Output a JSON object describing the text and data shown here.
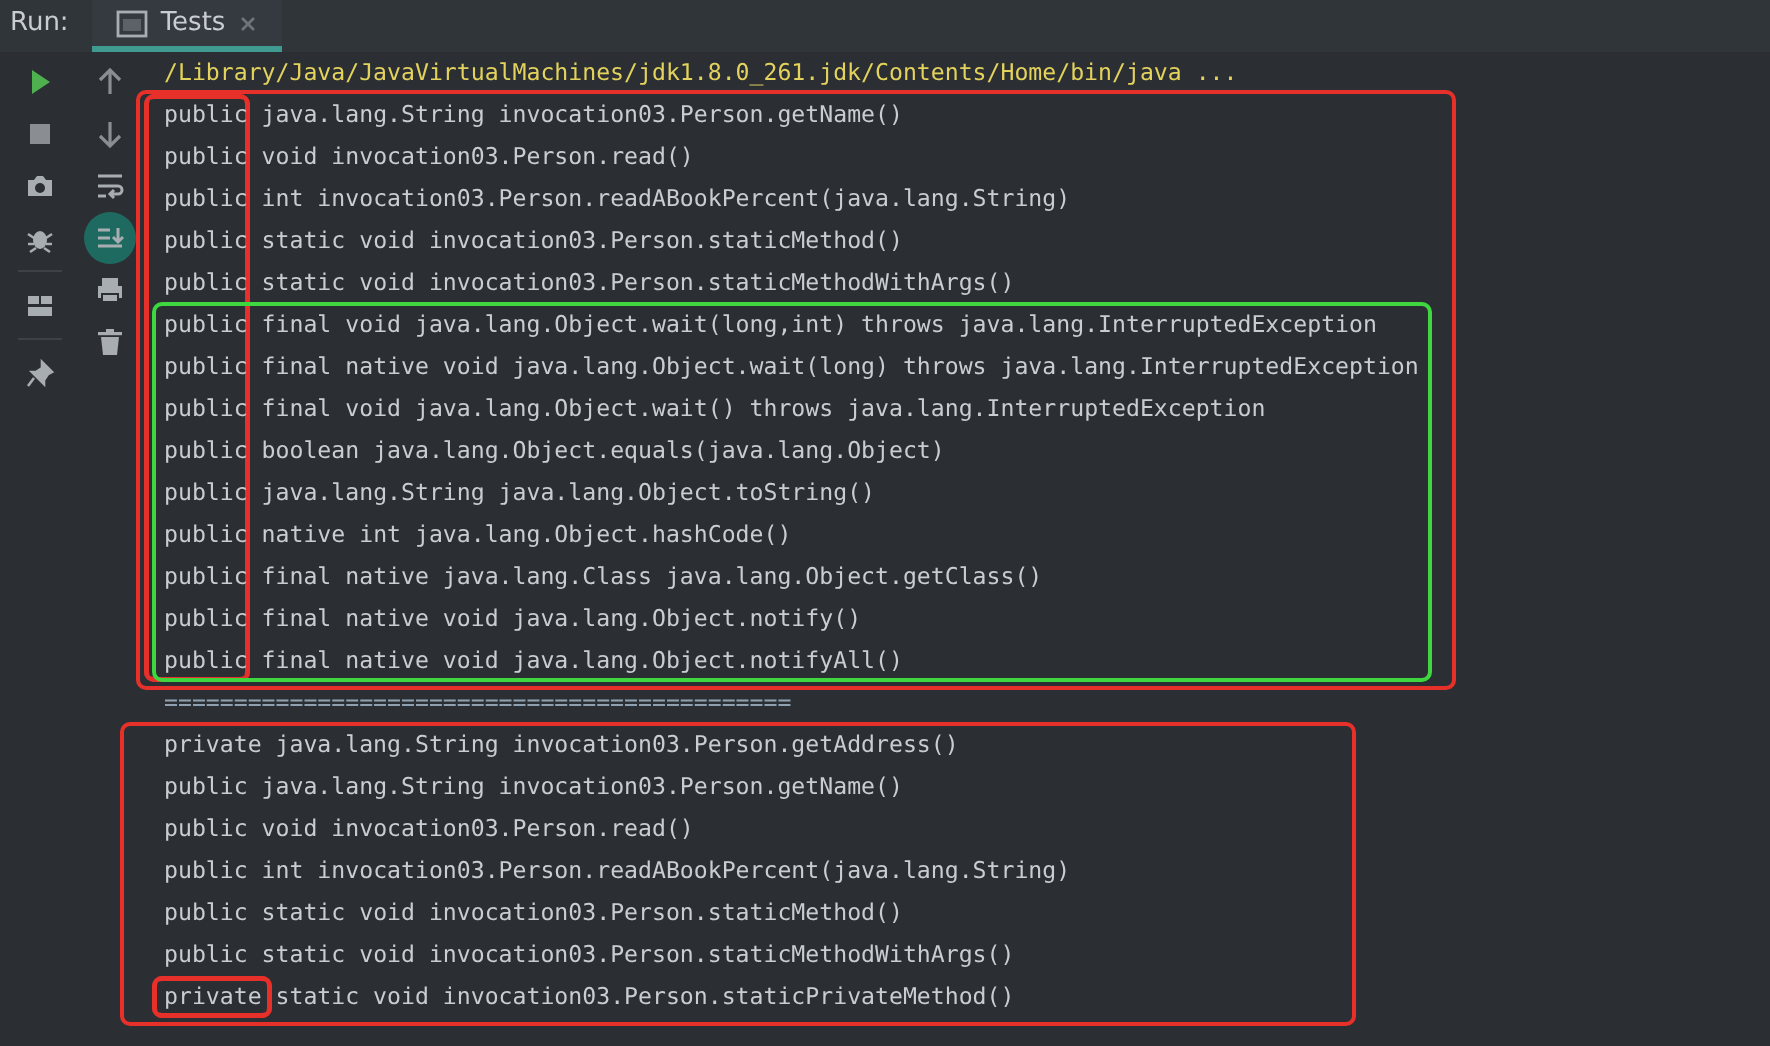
{
  "run_label": "Run:",
  "tab": {
    "label": "Tests",
    "selected": true
  },
  "actions": [
    {
      "kind": "run"
    },
    {
      "kind": "stop"
    },
    {
      "kind": "camera"
    },
    {
      "kind": "bug"
    },
    {
      "kind": "layout"
    },
    {
      "kind": "pin"
    }
  ],
  "toggles": [
    {
      "kind": "up",
      "on": false
    },
    {
      "kind": "down",
      "on": false
    },
    {
      "kind": "wrap",
      "on": false
    },
    {
      "kind": "scroll-end",
      "on": true
    },
    {
      "kind": "print",
      "on": false
    },
    {
      "kind": "trash",
      "on": false
    }
  ],
  "console": {
    "command": "/Library/Java/JavaVirtualMachines/jdk1.8.0_261.jdk/Contents/Home/bin/java ...",
    "blocks": [
      {
        "kind": "frame",
        "color": "#e8302a",
        "children": [
          {
            "kind": "line",
            "keyword": "public",
            "rest": "java.lang.String invocation03.Person.getName()",
            "keyword_marked": true
          },
          {
            "kind": "line",
            "keyword": "public",
            "rest": "void invocation03.Person.read()",
            "keyword_marked": true
          },
          {
            "kind": "line",
            "keyword": "public",
            "rest": "int invocation03.Person.readABookPercent(java.lang.String)",
            "keyword_marked": true
          },
          {
            "kind": "line",
            "keyword": "public",
            "rest": "static void invocation03.Person.staticMethod()",
            "keyword_marked": true
          },
          {
            "kind": "line",
            "keyword": "public",
            "rest": "static void invocation03.Person.staticMethodWithArgs()",
            "keyword_marked": true
          },
          {
            "kind": "frame",
            "color": "#3fd73f",
            "children": [
              {
                "kind": "line",
                "keyword": "public",
                "rest": "final void java.lang.Object.wait(long,int) throws java.lang.InterruptedException",
                "keyword_marked": true
              },
              {
                "kind": "line",
                "keyword": "public",
                "rest": "final native void java.lang.Object.wait(long) throws java.lang.InterruptedException",
                "keyword_marked": true
              },
              {
                "kind": "line",
                "keyword": "public",
                "rest": "final void java.lang.Object.wait() throws java.lang.InterruptedException",
                "keyword_marked": true
              },
              {
                "kind": "line",
                "keyword": "public",
                "rest": "boolean java.lang.Object.equals(java.lang.Object)",
                "keyword_marked": true
              },
              {
                "kind": "line",
                "keyword": "public",
                "rest": "java.lang.String java.lang.Object.toString()",
                "keyword_marked": true
              },
              {
                "kind": "line",
                "keyword": "public",
                "rest": "native int java.lang.Object.hashCode()",
                "keyword_marked": true
              },
              {
                "kind": "line",
                "keyword": "public",
                "rest": "final native java.lang.Class java.lang.Object.getClass()",
                "keyword_marked": true
              },
              {
                "kind": "line",
                "keyword": "public",
                "rest": "final native void java.lang.Object.notify()",
                "keyword_marked": true
              },
              {
                "kind": "line",
                "keyword": "public",
                "rest": "final native void java.lang.Object.notifyAll()",
                "keyword_marked": true
              }
            ]
          }
        ]
      },
      {
        "kind": "separator",
        "text": "============================================="
      },
      {
        "kind": "frame",
        "color": "#e8302a",
        "children": [
          {
            "kind": "line",
            "keyword": "private",
            "rest": "java.lang.String invocation03.Person.getAddress()",
            "keyword_marked": false
          },
          {
            "kind": "line",
            "keyword": "public",
            "rest": "java.lang.String invocation03.Person.getName()",
            "keyword_marked": false
          },
          {
            "kind": "line",
            "keyword": "public",
            "rest": "void invocation03.Person.read()",
            "keyword_marked": false
          },
          {
            "kind": "line",
            "keyword": "public",
            "rest": "int invocation03.Person.readABookPercent(java.lang.String)",
            "keyword_marked": false
          },
          {
            "kind": "line",
            "keyword": "public",
            "rest": "static void invocation03.Person.staticMethod()",
            "keyword_marked": false
          },
          {
            "kind": "line",
            "keyword": "public",
            "rest": "static void invocation03.Person.staticMethodWithArgs()",
            "keyword_marked": false
          },
          {
            "kind": "line",
            "keyword": "private",
            "rest": "static void invocation03.Person.staticPrivateMethod()",
            "keyword_marked": true
          }
        ]
      }
    ]
  }
}
